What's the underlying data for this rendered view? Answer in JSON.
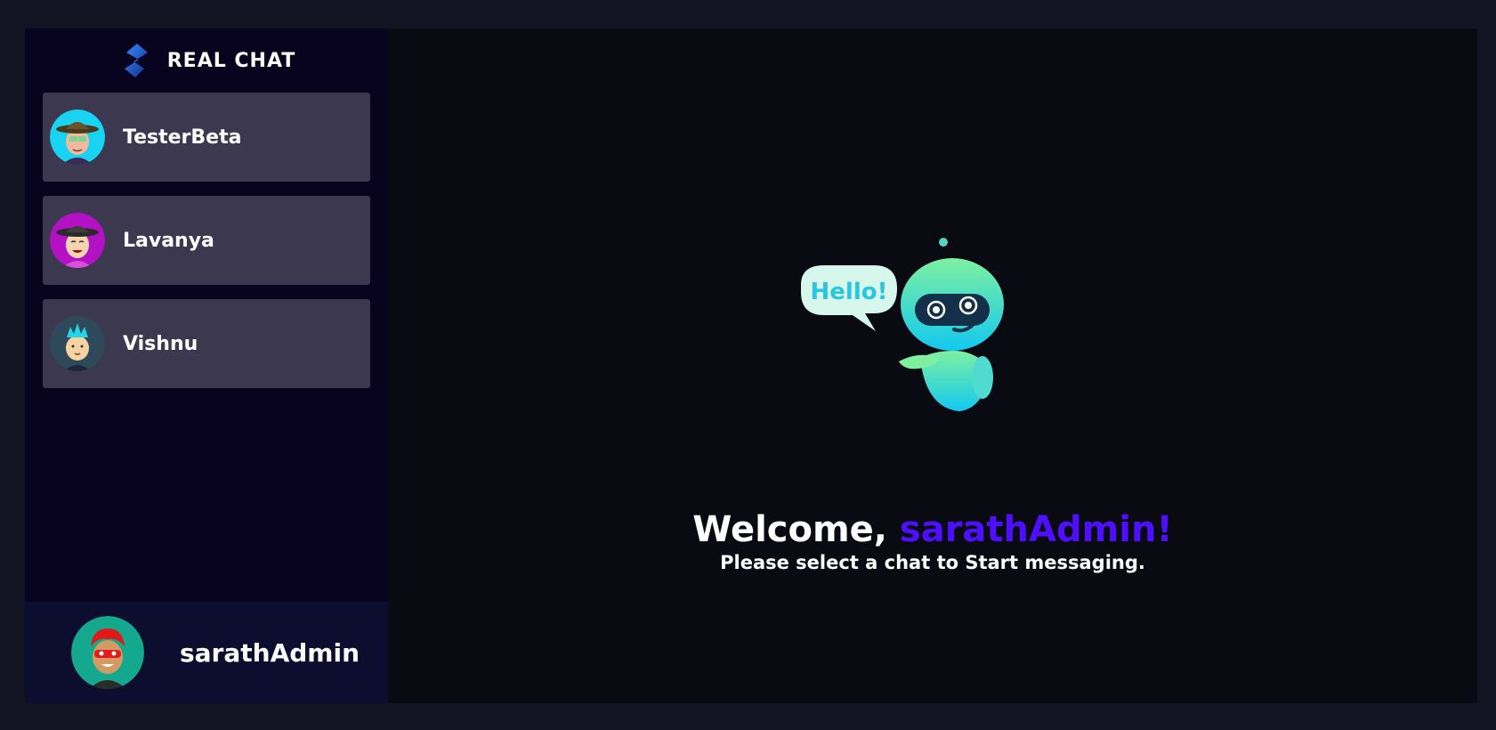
{
  "brand": {
    "title": "REAL CHAT",
    "logo_icon": "snapchat-like-logo-icon"
  },
  "contacts": [
    {
      "name": "TesterBeta",
      "avatar_icon": "hat-avatar-cyan",
      "avatar_bg": "#19d3f2"
    },
    {
      "name": "Lavanya",
      "avatar_icon": "hat-avatar-purple",
      "avatar_bg": "#b312c4"
    },
    {
      "name": "Vishnu",
      "avatar_icon": "spiky-hair-avatar",
      "avatar_bg": "#2e4a5a"
    }
  ],
  "current_user": {
    "name": "sarathAdmin",
    "avatar_icon": "red-hair-avatar",
    "avatar_bg": "#14a88f"
  },
  "welcome": {
    "prefix": "Welcome, ",
    "username": "sarathAdmin!",
    "subtitle": "Please select a chat to Start messaging.",
    "bubble_text": "Hello!"
  },
  "colors": {
    "page_bg": "#131324",
    "sidebar_bg": "#080420",
    "contact_bg": "#3b3850",
    "current_user_bg": "#0d0d30",
    "accent": "#4e0eff"
  }
}
